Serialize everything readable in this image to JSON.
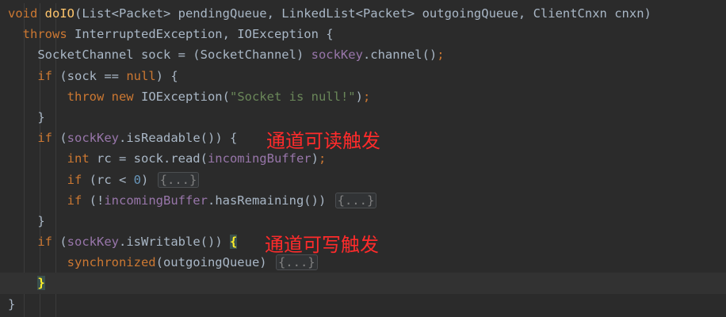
{
  "code": {
    "l1": {
      "kw_void": "void",
      "name": "doIO",
      "params": "(List<Packet> pendingQueue, LinkedList<Packet> outgoingQueue, ClientCnxn cnxn)"
    },
    "l2": {
      "kw_throws": "throws",
      "rest": " InterruptedException, IOException {"
    },
    "l3": {
      "a": "SocketChannel sock = (SocketChannel) ",
      "fld": "sockKey",
      "b": ".channel()",
      "semi": ";"
    },
    "l4": {
      "kw_if": "if",
      "a": " (sock == ",
      "kw_null": "null",
      "b": ") {"
    },
    "l5": {
      "kw_throw": "throw new",
      "a": " IOException(",
      "str": "\"Socket is null!\"",
      "b": ")",
      "semi": ";"
    },
    "l6": {
      "a": "}"
    },
    "l7": {
      "kw_if": "if",
      "a": " (",
      "fld": "sockKey",
      "b": ".isReadable()) {"
    },
    "l8": {
      "kw_int": "int",
      "a": " rc = sock.read(",
      "fld": "incomingBuffer",
      "b": ")",
      "semi": ";"
    },
    "l9": {
      "kw_if": "if",
      "a": " (rc < ",
      "num": "0",
      "b": ") ",
      "fold": "{...}"
    },
    "l10": {
      "kw_if": "if",
      "a": " (!",
      "fld": "incomingBuffer",
      "b": ".hasRemaining()) ",
      "fold": "{...}"
    },
    "l11": {
      "a": "}"
    },
    "l12": {
      "kw_if": "if",
      "a": " (",
      "fld": "sockKey",
      "b": ".isWritable()) ",
      "brace": "{"
    },
    "l13": {
      "kw_sync": "synchronized",
      "a": "(outgoingQueue) ",
      "fold": "{...}"
    },
    "l14": {
      "brace": "}"
    },
    "l15": {
      "a": "}"
    }
  },
  "annotations": {
    "readable": "通道可读触发",
    "writable": "通道可写触发"
  },
  "colors": {
    "background": "#2b2b2b",
    "keyword": "#cc7832",
    "function": "#ffc66d",
    "field": "#9876aa",
    "string": "#6a8759",
    "number": "#6897bb",
    "annotation": "#ff2b2b"
  }
}
